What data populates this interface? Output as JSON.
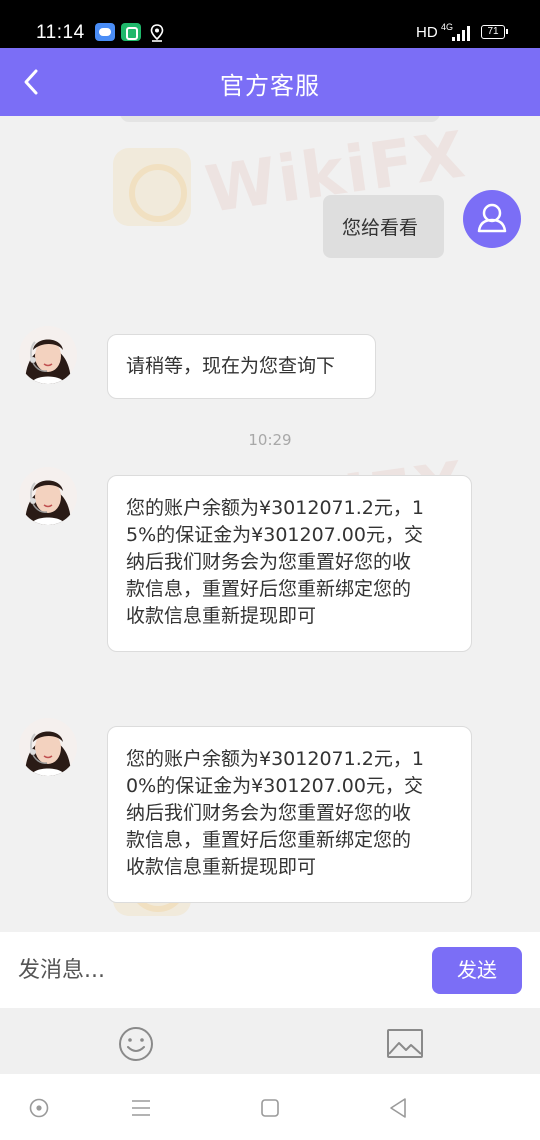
{
  "status_bar": {
    "time": "11:14",
    "hd": "HD",
    "network": "4G",
    "battery": "71",
    "icons": [
      "cloud-app-icon",
      "green-app-icon",
      "location-icon",
      "signal-icon",
      "battery-icon"
    ]
  },
  "header": {
    "title": "官方客服",
    "back_icon": "chevron-left-icon"
  },
  "messages": [
    {
      "from": "user",
      "text": "您给看看"
    },
    {
      "from": "agent",
      "text": "请稍等，现在为您查询下"
    },
    {
      "timestamp": "10:29"
    },
    {
      "from": "agent",
      "lines": [
        "您的账户余额为¥3012071.2元，1",
        "5%的保证金为¥301207.00元，交",
        "纳后我们财务会为您重置好您的收",
        "款信息，重置好后您重新绑定您的",
        "收款信息重新提现即可"
      ]
    },
    {
      "from": "agent",
      "lines": [
        "您的账户余额为¥3012071.2元，1",
        "0%的保证金为¥301207.00元，交",
        "纳后我们财务会为您重置好您的收",
        "款信息，重置好后您重新绑定您的",
        "收款信息重新提现即可"
      ]
    }
  ],
  "watermark": "WikiFX",
  "input": {
    "placeholder": "发消息...",
    "send_label": "发送"
  },
  "toolbar": [
    "emoji-icon",
    "image-icon"
  ],
  "nav": [
    "assist-icon",
    "menu-icon",
    "home-icon",
    "back-icon"
  ],
  "colors": {
    "accent": "#7b6ef6",
    "chat_bg": "#f1f1f1",
    "user_bubble": "#dedede",
    "agent_bubble": "#ffffff"
  }
}
